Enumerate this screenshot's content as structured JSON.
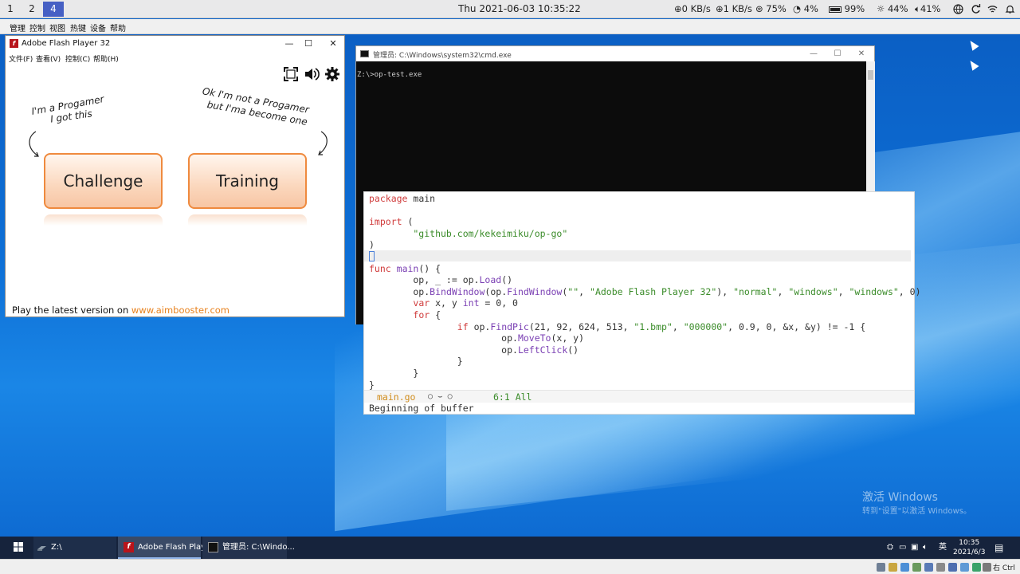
{
  "top_panel": {
    "workspaces": [
      "1",
      "2",
      "4"
    ],
    "active_workspace": "4",
    "clock": "Thu 2021-06-03 10:35:22",
    "net_down": "0 KB/s",
    "net_up": "1 KB/s",
    "cpu": "75%",
    "mem": "4%",
    "battery": "99%",
    "brightness": "44%",
    "volume": "41%"
  },
  "vm_menu": [
    "管理",
    "控制",
    "视图",
    "热键",
    "设备",
    "帮助"
  ],
  "flash_window": {
    "title": "Adobe Flash Player 32",
    "menu": [
      "文件(F)",
      "查看(V)",
      "控制(C)",
      "帮助(H)"
    ],
    "note_left_line1": "I'm a Progamer",
    "note_left_line2": "I got this",
    "note_right_line1": "Ok I'm not a Progamer",
    "note_right_line2": "but I'ma become one",
    "button_challenge": "Challenge",
    "button_training": "Training",
    "footer_text": "Play the latest version on ",
    "footer_link": "www.aimbooster.com"
  },
  "cmd_window": {
    "title": "管理员: C:\\Windows\\system32\\cmd.exe",
    "line": "Z:\\>op-test.exe"
  },
  "editor": {
    "lines": [
      [
        {
          "t": "package",
          "c": "kw"
        },
        {
          "t": " main",
          "c": "pk"
        }
      ],
      [],
      [
        {
          "t": "import",
          "c": "kw"
        },
        {
          "t": " (",
          "c": "pk"
        }
      ],
      [
        {
          "t": "        \"github.com/kekeimiku/op-go\"",
          "c": "st"
        }
      ],
      [
        {
          "t": ")",
          "c": "pk"
        }
      ],
      [],
      [
        {
          "t": "func",
          "c": "kw"
        },
        {
          "t": " ",
          "c": "pk"
        },
        {
          "t": "main",
          "c": "fn"
        },
        {
          "t": "() {",
          "c": "pk"
        }
      ],
      [
        {
          "t": "        op, _ := op.",
          "c": "pk"
        },
        {
          "t": "Load",
          "c": "fn"
        },
        {
          "t": "()",
          "c": "pk"
        }
      ],
      [
        {
          "t": "        op.",
          "c": "pk"
        },
        {
          "t": "BindWindow",
          "c": "fn"
        },
        {
          "t": "(op.",
          "c": "pk"
        },
        {
          "t": "FindWindow",
          "c": "fn"
        },
        {
          "t": "(",
          "c": "pk"
        },
        {
          "t": "\"\"",
          "c": "st"
        },
        {
          "t": ", ",
          "c": "pk"
        },
        {
          "t": "\"Adobe Flash Player 32\"",
          "c": "st"
        },
        {
          "t": "), ",
          "c": "pk"
        },
        {
          "t": "\"normal\"",
          "c": "st"
        },
        {
          "t": ", ",
          "c": "pk"
        },
        {
          "t": "\"windows\"",
          "c": "st"
        },
        {
          "t": ", ",
          "c": "pk"
        },
        {
          "t": "\"windows\"",
          "c": "st"
        },
        {
          "t": ", 0)",
          "c": "pk"
        }
      ],
      [
        {
          "t": "        ",
          "c": "pk"
        },
        {
          "t": "var",
          "c": "kw"
        },
        {
          "t": " x, y ",
          "c": "pk"
        },
        {
          "t": "int",
          "c": "fn"
        },
        {
          "t": " = 0, 0",
          "c": "pk"
        }
      ],
      [
        {
          "t": "        ",
          "c": "pk"
        },
        {
          "t": "for",
          "c": "kw"
        },
        {
          "t": " {",
          "c": "pk"
        }
      ],
      [
        {
          "t": "                ",
          "c": "pk"
        },
        {
          "t": "if",
          "c": "kw"
        },
        {
          "t": " op.",
          "c": "pk"
        },
        {
          "t": "FindPic",
          "c": "fn"
        },
        {
          "t": "(21, 92, 624, 513, ",
          "c": "pk"
        },
        {
          "t": "\"1.bmp\"",
          "c": "st"
        },
        {
          "t": ", ",
          "c": "pk"
        },
        {
          "t": "\"000000\"",
          "c": "st"
        },
        {
          "t": ", 0.9, 0, &x, &y) != -1 {",
          "c": "pk"
        }
      ],
      [
        {
          "t": "                        op.",
          "c": "pk"
        },
        {
          "t": "MoveTo",
          "c": "fn"
        },
        {
          "t": "(x, y)",
          "c": "pk"
        }
      ],
      [
        {
          "t": "                        op.",
          "c": "pk"
        },
        {
          "t": "LeftClick",
          "c": "fn"
        },
        {
          "t": "()",
          "c": "pk"
        }
      ],
      [
        {
          "t": "                }",
          "c": "pk"
        }
      ],
      [
        {
          "t": "        }",
          "c": "pk"
        }
      ],
      [
        {
          "t": "}",
          "c": "pk"
        }
      ]
    ],
    "mode_file": "main.go",
    "mode_icons": "○ ⌣ ○",
    "mode_pos": "6:1 All",
    "echo": "Beginning of buffer"
  },
  "watermark": {
    "title": "激活 Windows",
    "subtitle": "转到\"设置\"以激活 Windows。"
  },
  "taskbar": {
    "items": [
      "Z:\\",
      "Adobe Flash Play...",
      "管理员: C:\\Windo..."
    ],
    "ime": "英",
    "time": "10:35",
    "date": "2021/6/3"
  },
  "vm_status": {
    "host_key": "右 Ctrl"
  },
  "colors": {
    "accent_workspace": "#4660c4",
    "button_border": "#ef8a3e",
    "link": "#e8821e",
    "keyword": "#d03c3c",
    "function": "#7a3fb3",
    "string": "#3b8c2a"
  }
}
